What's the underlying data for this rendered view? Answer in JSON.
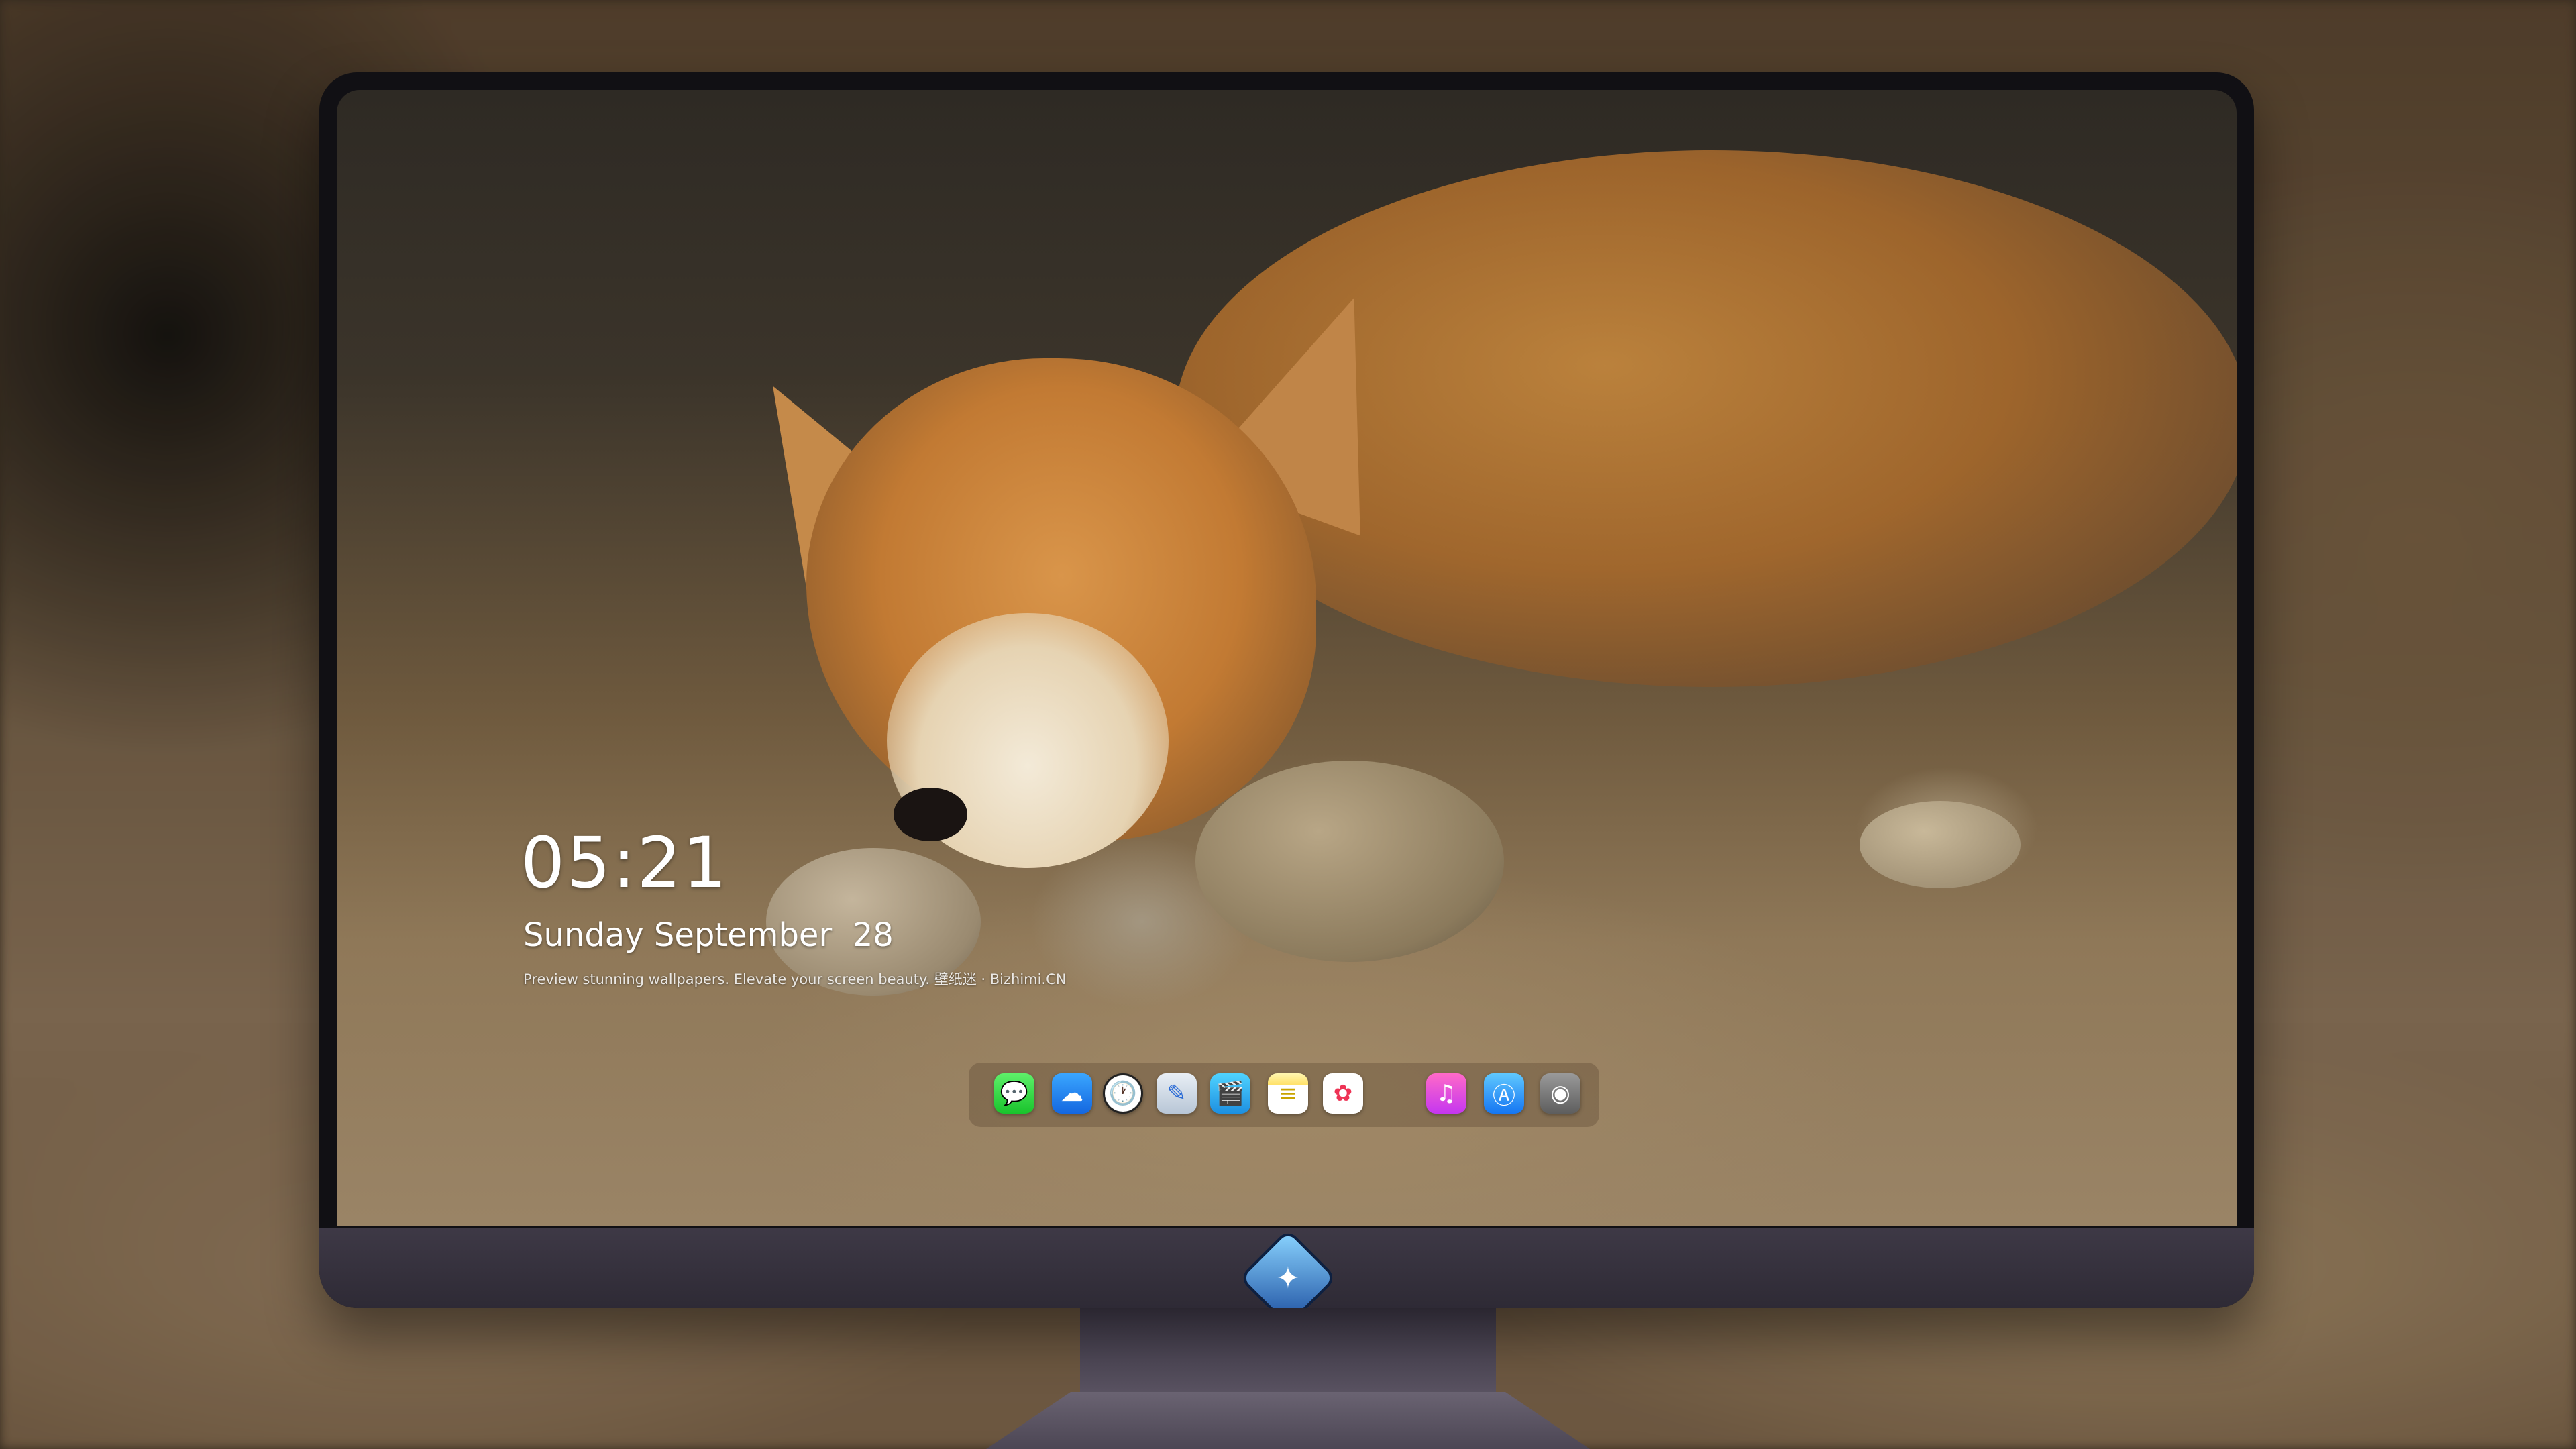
{
  "lockscreen": {
    "time": "05:21",
    "date": "Sunday September  28",
    "tagline": "Preview stunning wallpapers. Elevate your screen beauty. 壁纸迷 · Bizhimi.CN"
  },
  "wallpaper": {
    "subject": "sleeping-red-fox"
  },
  "dock": {
    "items": [
      {
        "name": "messages",
        "icon": "message-bubble-icon",
        "color": "#19c32c"
      },
      {
        "name": "weather",
        "icon": "cloud-sun-icon",
        "color": "#1467e0"
      },
      {
        "name": "clock",
        "icon": "clock-icon",
        "color": "#ffffff"
      },
      {
        "name": "preview",
        "icon": "preview-icon",
        "color": "#b8c6d6"
      },
      {
        "name": "clips",
        "icon": "clapperboard-icon",
        "color": "#1d8fe0"
      },
      {
        "name": "notes",
        "icon": "notes-icon",
        "color": "#ffe066"
      },
      {
        "name": "photos",
        "icon": "photos-icon",
        "color": "#ffffff"
      },
      {
        "name": "music",
        "icon": "music-note-icon",
        "color": "#c536f0"
      },
      {
        "name": "app-store",
        "icon": "app-store-icon",
        "color": "#1576f2"
      },
      {
        "name": "camera",
        "icon": "camera-icon",
        "color": "#5e5e5e"
      }
    ]
  },
  "monitor": {
    "logo": "mascot-logo-icon",
    "logo_glyph": "✦"
  }
}
